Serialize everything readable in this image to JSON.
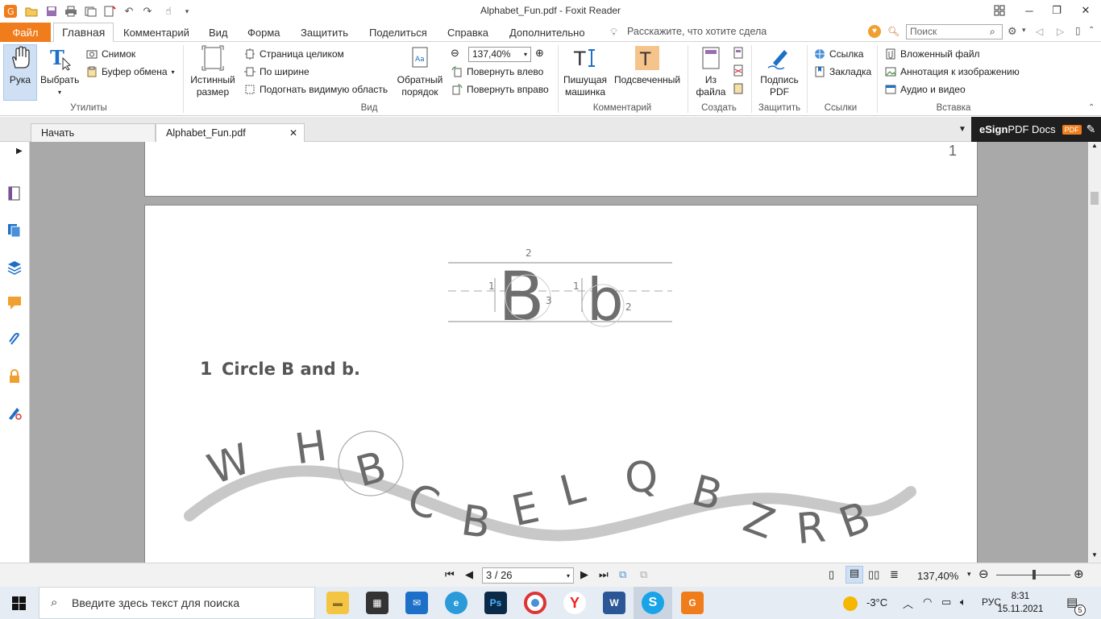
{
  "window": {
    "title": "Alphabet_Fun.pdf - Foxit Reader"
  },
  "menu": {
    "file": "Файл",
    "tabs": [
      "Главная",
      "Комментарий",
      "Вид",
      "Форма",
      "Защитить",
      "Поделиться",
      "Справка",
      "Дополнительно"
    ],
    "tell_me": "Расскажите, что хотите сдела",
    "search_placeholder": "Поиск"
  },
  "ribbon": {
    "hand": "Рука",
    "select": "Выбрать",
    "snapshot": "Снимок",
    "clipboard": "Буфер обмена",
    "group_utilities": "Утилиты",
    "actual_size_1": "Истинный",
    "actual_size_2": "размер",
    "fit_page": "Страница целиком",
    "fit_width": "По ширине",
    "fit_visible": "Подогнать видимую область",
    "reverse_1": "Обратный",
    "reverse_2": "порядок",
    "zoom_value": "137,40%",
    "rotate_left": "Повернуть влево",
    "rotate_right": "Повернуть вправо",
    "group_view": "Вид",
    "typewriter_1": "Пишущая",
    "typewriter_2": "машинка",
    "highlight": "Подсвеченный",
    "group_comment": "Комментарий",
    "from_file_1": "Из",
    "from_file_2": "файла",
    "group_create": "Создать",
    "sign_1": "Подпись",
    "sign_2": "PDF",
    "group_protect": "Защитить",
    "link": "Ссылка",
    "bookmark": "Закладка",
    "group_links": "Ссылки",
    "attached_file": "Вложенный файл",
    "image_annotation": "Аннотация к изображению",
    "audio_video": "Аудио и видео",
    "group_insert": "Вставка"
  },
  "doc_tabs": {
    "start": "Начать",
    "file": "Alphabet_Fun.pdf"
  },
  "esign": {
    "bold": "eSign",
    "rest": " PDF Docs",
    "badge": "PDF"
  },
  "page": {
    "prev_page_number": "1",
    "letters_big": [
      "B",
      "b"
    ],
    "stroke_numbers": [
      "2",
      "1",
      "3",
      "1",
      "2"
    ],
    "exercise_number": "1",
    "exercise_text": "Circle B and b.",
    "wave_letters": [
      "W",
      "H",
      "B",
      "C",
      "B",
      "E",
      "L",
      "Q",
      "B",
      "Z",
      "R",
      "B"
    ]
  },
  "status": {
    "page_indicator": "3 / 26",
    "zoom": "137,40%"
  },
  "taskbar": {
    "search_text": "Введите здесь текст для поиска",
    "weather": "-3°C",
    "lang": "РУС",
    "time": "8:31",
    "date": "15.11.2021",
    "notifications": "5"
  }
}
